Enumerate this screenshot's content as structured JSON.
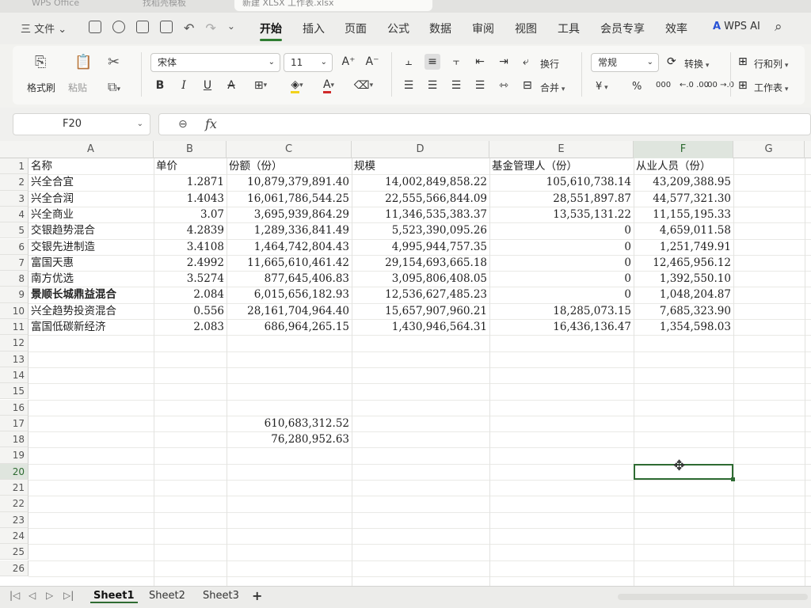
{
  "window_tabs": [
    "WPS Office",
    "找稻壳模板",
    "新建 XLSX 工作表.xlsx"
  ],
  "menu": {
    "file_label": "三 文件 ⌄",
    "items": [
      "开始",
      "插入",
      "页面",
      "公式",
      "数据",
      "审阅",
      "视图",
      "工具",
      "会员专享",
      "效率"
    ],
    "active": "开始",
    "wps_ai": "WPS AI"
  },
  "ribbon": {
    "format_painter": "格式刷",
    "paste": "粘贴",
    "font_name": "宋体",
    "font_size": "11",
    "wrap": "换行",
    "merge": "合并",
    "number_format": "常规",
    "convert": "转换",
    "row_col": "行和列",
    "worksheet": "工作表",
    "currency": "¥",
    "percent": "%",
    "thousands": "000",
    "dec_inc": "←.0 .00",
    "dec_dec": ".00 →.0"
  },
  "formula_bar": {
    "name_box": "F20",
    "fx": "fx",
    "content": ""
  },
  "columns": [
    "A",
    "B",
    "C",
    "D",
    "E",
    "F",
    "G"
  ],
  "selected_column": "F",
  "selected_row": 20,
  "rows_visible": 26,
  "table": {
    "header": [
      "名称",
      "单价",
      "份额（份）",
      "规模",
      "基金管理人（份）",
      "从业人员（份）"
    ],
    "rows": [
      [
        "兴全合宜",
        "1.2871",
        "10,879,379,891.40",
        "14,002,849,858.22",
        "105,610,738.14",
        "43,209,388.95"
      ],
      [
        "兴全合润",
        "1.4043",
        "16,061,786,544.25",
        "22,555,566,844.09",
        "28,551,897.87",
        "44,577,321.30"
      ],
      [
        "兴全商业",
        "3.07",
        "3,695,939,864.29",
        "11,346,535,383.37",
        "13,535,131.22",
        "11,155,195.33"
      ],
      [
        "交银趋势混合",
        "4.2839",
        "1,289,336,841.49",
        "5,523,390,095.26",
        "0",
        "4,659,011.58"
      ],
      [
        "交银先进制造",
        "3.4108",
        "1,464,742,804.43",
        "4,995,944,757.35",
        "0",
        "1,251,749.91"
      ],
      [
        "富国天惠",
        "2.4992",
        "11,665,610,461.42",
        "29,154,693,665.18",
        "0",
        "12,465,956.12"
      ],
      [
        "南方优选",
        "3.5274",
        "877,645,406.83",
        "3,095,806,408.05",
        "0",
        "1,392,550.10"
      ],
      [
        "景顺长城鼎益混合",
        "2.084",
        "6,015,656,182.93",
        "12,536,627,485.23",
        "0",
        "1,048,204.87"
      ],
      [
        "兴全趋势投资混合",
        "0.556",
        "28,161,704,964.40",
        "15,657,907,960.21",
        "18,285,073.15",
        "7,685,323.90"
      ],
      [
        "富国低碳新经济",
        "2.083",
        "686,964,265.15",
        "1,430,946,564.31",
        "16,436,136.47",
        "1,354,598.03"
      ]
    ],
    "bold_row_index": 7,
    "extra": {
      "C17": "610,683,312.52",
      "C18": "76,280,952.63"
    }
  },
  "sheets": [
    "Sheet1",
    "Sheet2",
    "Sheet3"
  ],
  "active_sheet": "Sheet1",
  "add_sheet": "+"
}
